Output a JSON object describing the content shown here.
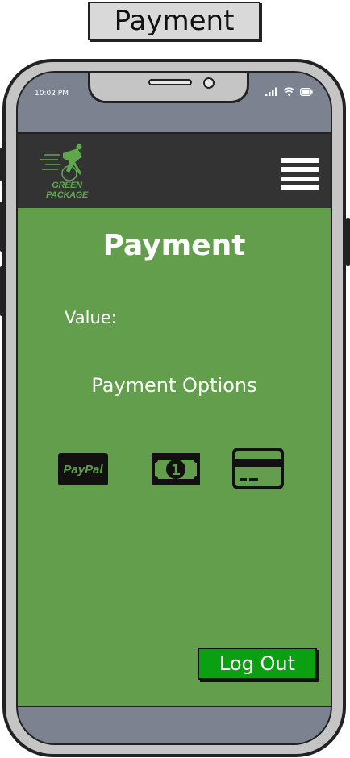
{
  "mockup": {
    "label": "Payment"
  },
  "status_bar": {
    "time": "10:02 PM",
    "icons": [
      "signal-icon",
      "wifi-icon",
      "battery-icon"
    ]
  },
  "app_bar": {
    "logo_text": "GREEN PACKAGE",
    "menu_icon": "hamburger-menu-icon"
  },
  "page": {
    "title": "Payment",
    "value_label": "Value:",
    "options_label": "Payment Options",
    "options": [
      {
        "id": "paypal",
        "label": "PayPal",
        "icon": "paypal-icon"
      },
      {
        "id": "cash",
        "label": "1",
        "icon": "cash-icon"
      },
      {
        "id": "card",
        "icon": "credit-card-icon"
      }
    ]
  },
  "actions": {
    "logout_label": "Log Out"
  },
  "colors": {
    "content_bg": "#629e4c",
    "app_bar_bg": "#333333",
    "logout_bg": "#0aa012"
  }
}
